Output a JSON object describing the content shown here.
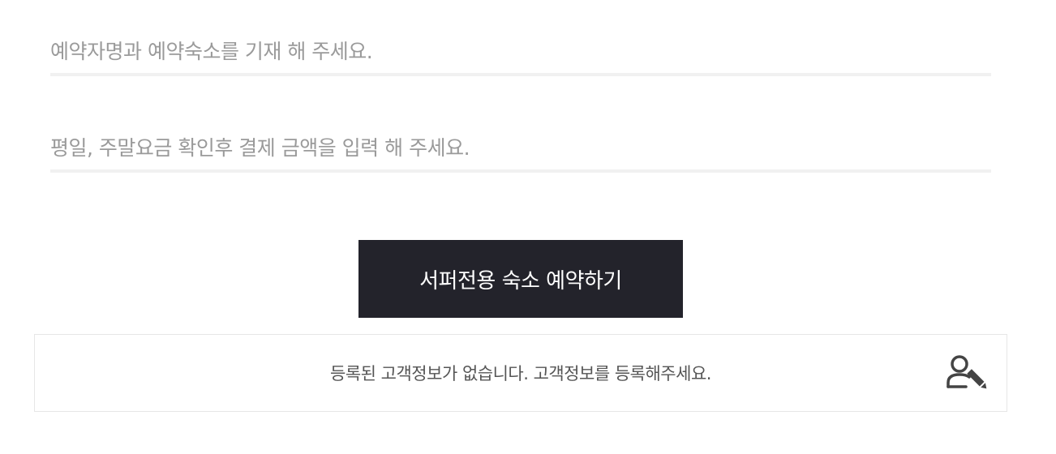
{
  "form": {
    "name_field": {
      "value": "",
      "placeholder": "예약자명과 예약숙소를 기재 해 주세요."
    },
    "amount_field": {
      "value": "",
      "placeholder": "평일, 주말요금 확인후 결제 금액을 입력 해 주세요."
    }
  },
  "reserve_button": {
    "label": "서퍼전용 숙소 예약하기",
    "background": "#23232b",
    "text_color": "#ffffff"
  },
  "customer_notice": {
    "text": "등록된 고객정보가 없습니다. 고객정보를 등록해주세요.",
    "icon": "user-edit-icon"
  }
}
